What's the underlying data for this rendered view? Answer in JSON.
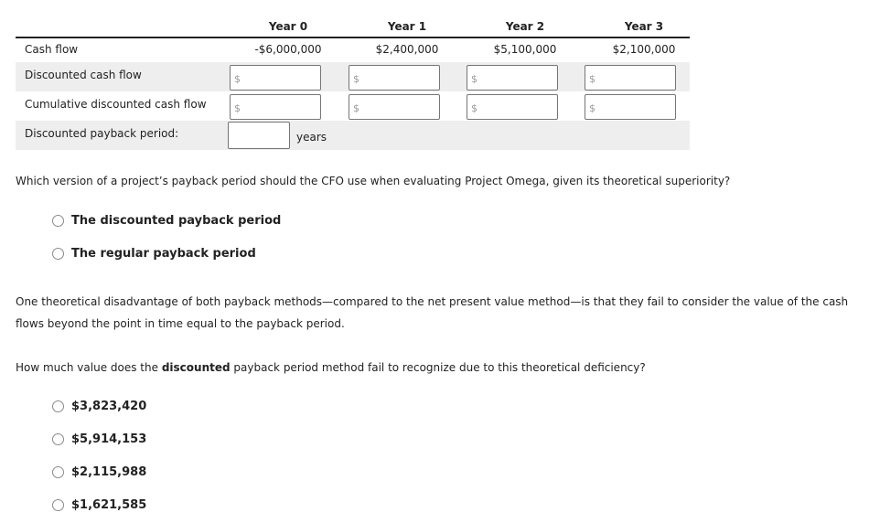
{
  "table": {
    "headers": [
      "Year 0",
      "Year 1",
      "Year 2",
      "Year 3"
    ],
    "rows": {
      "cash_flow": {
        "label": "Cash flow",
        "values": [
          "-$6,000,000",
          "$2,400,000",
          "$5,100,000",
          "$2,100,000"
        ]
      },
      "discounted_cash_flow": {
        "label": "Discounted cash flow",
        "input_prefix": "$",
        "values": [
          "",
          "",
          "",
          ""
        ]
      },
      "cumulative_discounted_cash_flow": {
        "label": "Cumulative discounted cash flow",
        "input_prefix": "$",
        "values": [
          "",
          "",
          "",
          ""
        ]
      },
      "discounted_payback_period": {
        "label": "Discounted payback period:",
        "value": "",
        "unit": "years"
      }
    }
  },
  "question1": {
    "text": "Which version of a project’s payback period should the CFO use when evaluating Project Omega, given its theoretical superiority?",
    "options": [
      "The discounted payback period",
      "The regular payback period"
    ]
  },
  "paragraph": {
    "line1": "One theoretical disadvantage of both payback methods—compared to the net present value method—is that they fail to consider the value of the cash",
    "line2": "flows beyond the point in time equal to the payback period."
  },
  "question2": {
    "prefix": "How much value does the ",
    "bold": "discounted",
    "suffix": " payback period method fail to recognize due to this theoretical deficiency?",
    "options": [
      "$3,823,420",
      "$5,914,153",
      "$2,115,988",
      "$1,621,585"
    ]
  }
}
